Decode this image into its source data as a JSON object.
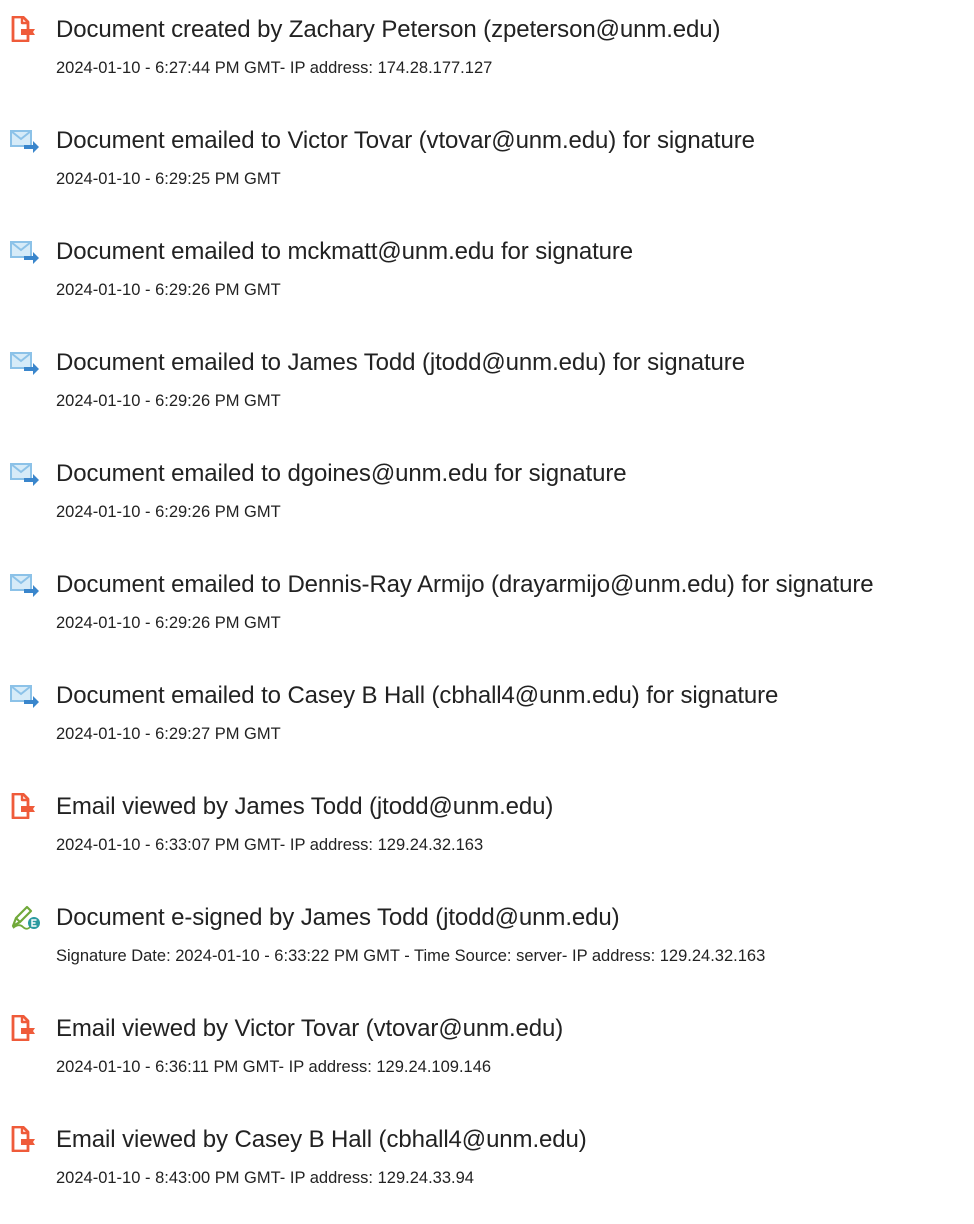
{
  "colors": {
    "doc_icon": "#ef5b3a",
    "mail_icon": "#8cc2e8",
    "mail_arrow": "#3a86cc",
    "sign_icon": "#71a93a",
    "sign_badge": "#2a9a9f",
    "text": "#222222"
  },
  "events": [
    {
      "icon": "document-icon",
      "title": "Document created by Zachary Peterson (zpeterson@unm.edu)",
      "detail": "2024-01-10 - 6:27:44 PM GMT- IP address: 174.28.177.127"
    },
    {
      "icon": "email-sent-icon",
      "title": "Document emailed to Victor Tovar (vtovar@unm.edu) for signature",
      "detail": "2024-01-10 - 6:29:25 PM GMT"
    },
    {
      "icon": "email-sent-icon",
      "title": "Document emailed to mckmatt@unm.edu for signature",
      "detail": "2024-01-10 - 6:29:26 PM GMT"
    },
    {
      "icon": "email-sent-icon",
      "title": "Document emailed to James Todd (jtodd@unm.edu) for signature",
      "detail": "2024-01-10 - 6:29:26 PM GMT"
    },
    {
      "icon": "email-sent-icon",
      "title": "Document emailed to dgoines@unm.edu for signature",
      "detail": "2024-01-10 - 6:29:26 PM GMT"
    },
    {
      "icon": "email-sent-icon",
      "title": "Document emailed to Dennis-Ray Armijo (drayarmijo@unm.edu) for signature",
      "detail": "2024-01-10 - 6:29:26 PM GMT"
    },
    {
      "icon": "email-sent-icon",
      "title": "Document emailed to Casey B Hall (cbhall4@unm.edu) for signature",
      "detail": "2024-01-10 - 6:29:27 PM GMT"
    },
    {
      "icon": "document-icon",
      "title": "Email viewed by James Todd (jtodd@unm.edu)",
      "detail": "2024-01-10 - 6:33:07 PM GMT- IP address: 129.24.32.163"
    },
    {
      "icon": "esign-icon",
      "title": "Document e-signed by James Todd (jtodd@unm.edu)",
      "detail": "Signature Date: 2024-01-10 - 6:33:22 PM GMT - Time Source: server- IP address: 129.24.32.163"
    },
    {
      "icon": "document-icon",
      "title": "Email viewed by Victor Tovar (vtovar@unm.edu)",
      "detail": "2024-01-10 - 6:36:11 PM GMT- IP address: 129.24.109.146"
    },
    {
      "icon": "document-icon",
      "title": "Email viewed by Casey B Hall (cbhall4@unm.edu)",
      "detail": "2024-01-10 - 8:43:00 PM GMT- IP address: 129.24.33.94"
    }
  ]
}
